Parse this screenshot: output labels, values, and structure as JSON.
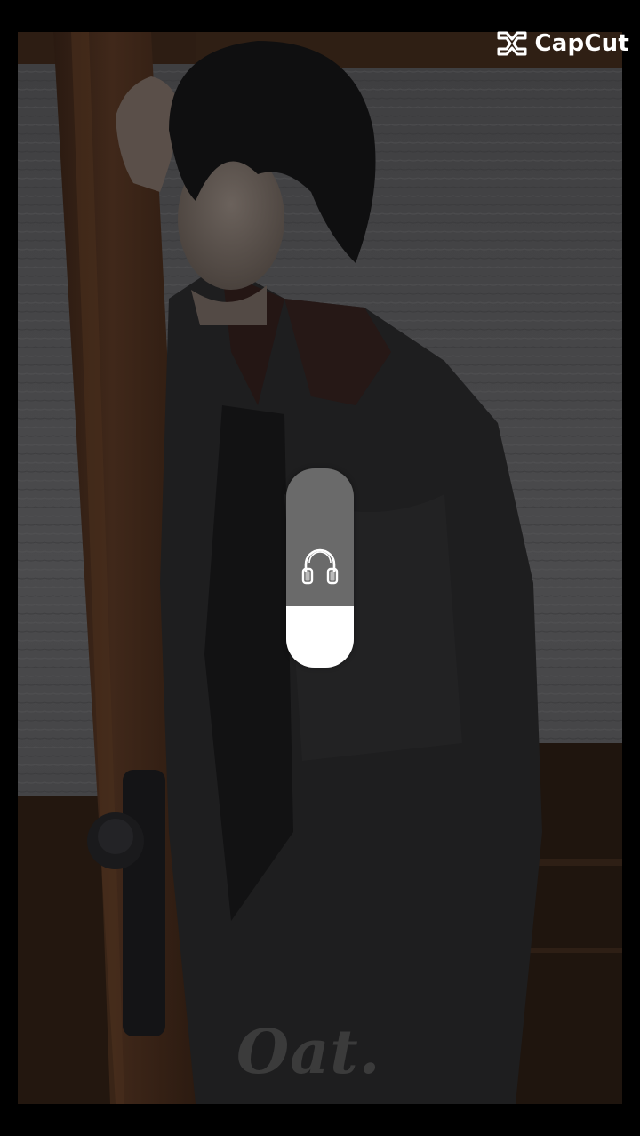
{
  "watermark": {
    "brand": "CapCut",
    "icon": "capcut-logo-icon"
  },
  "volume_hud": {
    "icon": "headphones-icon",
    "level": 0.31,
    "track_color": "#6a6a6a",
    "fill_color": "#ffffff"
  },
  "photo": {
    "caption": "Oat."
  },
  "colors": {
    "background": "#000000",
    "wood": "#3a2418",
    "coat": "#1e1e1f",
    "glass": "#4a4a4c"
  }
}
